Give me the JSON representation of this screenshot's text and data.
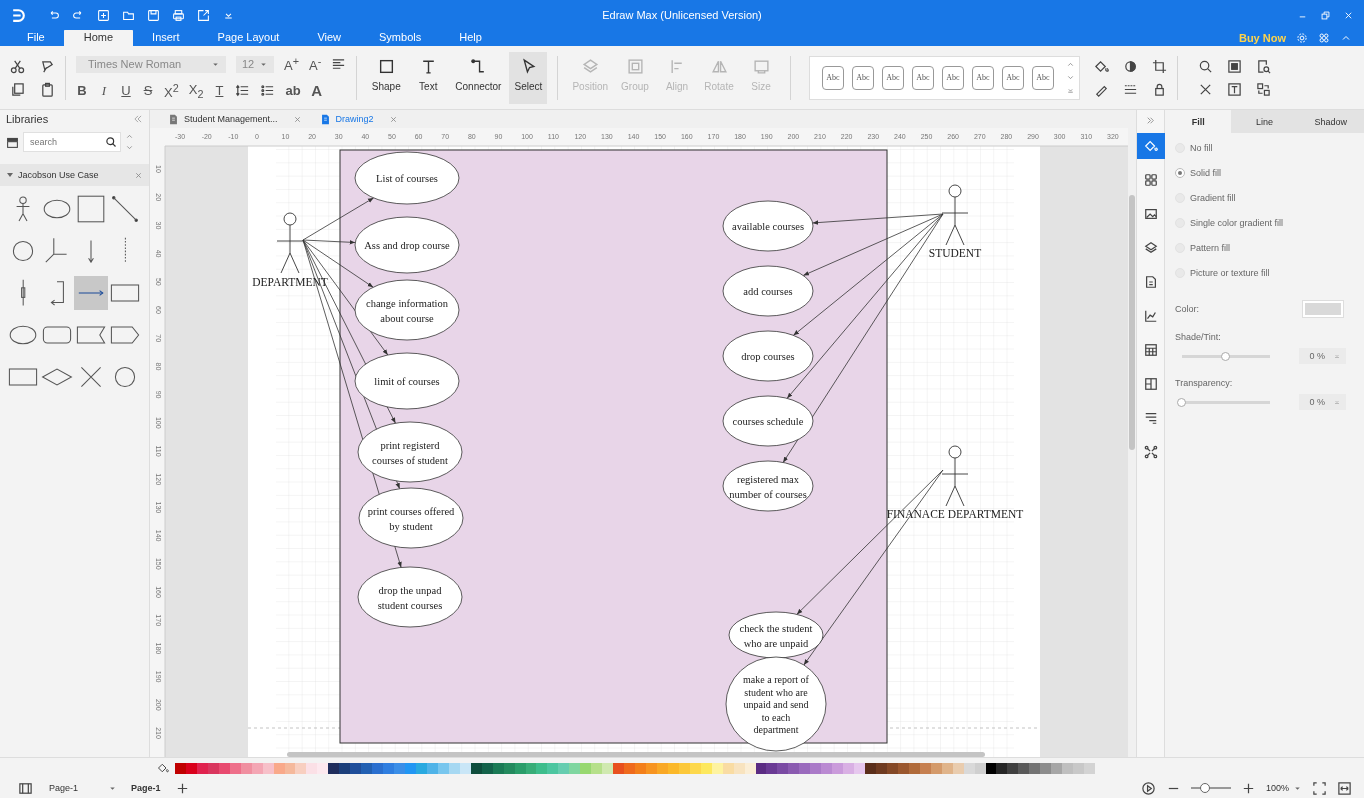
{
  "window": {
    "title": "Edraw Max (Unlicensed Version)"
  },
  "menu_tabs": [
    {
      "label": "File",
      "selected": false
    },
    {
      "label": "Home",
      "selected": true
    },
    {
      "label": "Insert",
      "selected": false
    },
    {
      "label": "Page Layout",
      "selected": false
    },
    {
      "label": "View",
      "selected": false
    },
    {
      "label": "Symbols",
      "selected": false
    },
    {
      "label": "Help",
      "selected": false
    }
  ],
  "buy_now": "Buy Now",
  "ribbon": {
    "font_family": "Times New Roman",
    "font_size": "12",
    "size_buttons": [
      "A$^{+}$",
      "A$^{-}$"
    ],
    "format_buttons": [
      {
        "label": "B",
        "kind": "bold"
      },
      {
        "label": "I",
        "kind": "italic"
      },
      {
        "label": "U",
        "kind": "underline"
      },
      {
        "label": "S",
        "kind": "strike"
      },
      {
        "label": "X$^{2}$",
        "kind": "plain"
      },
      {
        "label": "X$_{2}$",
        "kind": "plain"
      },
      {
        "label": "T",
        "kind": "underline"
      },
      {
        "label": "ab",
        "kind": "bold"
      },
      {
        "label": "A",
        "kind": "large"
      }
    ],
    "tools": [
      {
        "label": "Shape",
        "kind": "shape",
        "selected": false,
        "disabled": false
      },
      {
        "label": "Text",
        "kind": "text",
        "selected": false,
        "disabled": false
      },
      {
        "label": "Connector",
        "kind": "connector",
        "selected": false,
        "disabled": false
      },
      {
        "label": "Select",
        "kind": "select",
        "selected": true,
        "disabled": false
      },
      {
        "label": "Position",
        "kind": "position",
        "selected": false,
        "disabled": true
      },
      {
        "label": "Group",
        "kind": "group",
        "selected": false,
        "disabled": true
      },
      {
        "label": "Align",
        "kind": "align",
        "selected": false,
        "disabled": true
      },
      {
        "label": "Rotate",
        "kind": "rotate",
        "selected": false,
        "disabled": true
      },
      {
        "label": "Size",
        "kind": "size",
        "selected": false,
        "disabled": true
      }
    ],
    "styles": [
      "Abc",
      "Abc",
      "Abc",
      "Abc",
      "Abc",
      "Abc",
      "Abc",
      "Abc"
    ]
  },
  "libraries": {
    "title": "Libraries",
    "search": {
      "placeholder": "search"
    },
    "category": {
      "label": "Jacobson Use Case",
      "expanded": true
    },
    "shapes": [
      {
        "kind": "actor",
        "selected": false
      },
      {
        "kind": "ellipse",
        "selected": false
      },
      {
        "kind": "square",
        "selected": false
      },
      {
        "kind": "line",
        "selected": false
      },
      {
        "kind": "circle",
        "selected": false
      },
      {
        "kind": "branch",
        "selected": false
      },
      {
        "kind": "arrow-down",
        "selected": false
      },
      {
        "kind": "dotted",
        "selected": false
      },
      {
        "kind": "bar",
        "selected": false
      },
      {
        "kind": "elbow",
        "selected": false
      },
      {
        "kind": "arrow-right",
        "selected": true
      },
      {
        "kind": "rect",
        "selected": false
      },
      {
        "kind": "ellipse",
        "selected": false
      },
      {
        "kind": "rounded",
        "selected": false
      },
      {
        "kind": "ribbon",
        "selected": false
      },
      {
        "kind": "pentagon",
        "selected": false
      },
      {
        "kind": "rect",
        "selected": false
      },
      {
        "kind": "diamond",
        "selected": false
      },
      {
        "kind": "cross",
        "selected": false
      },
      {
        "kind": "circle",
        "selected": false
      }
    ]
  },
  "document_tabs": [
    {
      "label": "Student Management...",
      "selected": false
    },
    {
      "label": "Drawing2",
      "selected": true
    }
  ],
  "ruler": {
    "horizontal": [
      "-30",
      "-20",
      "-10",
      "0",
      "10",
      "20",
      "30",
      "40",
      "50",
      "60",
      "70",
      "80",
      "90",
      "100",
      "110",
      "120",
      "130",
      "140",
      "150",
      "160",
      "170",
      "180",
      "190",
      "200",
      "210",
      "220",
      "230",
      "240",
      "250",
      "260",
      "270",
      "280",
      "290",
      "300",
      "310",
      "320"
    ],
    "vertical": [
      "10",
      "20",
      "30",
      "40",
      "50",
      "60",
      "70",
      "80",
      "90",
      "100",
      "110",
      "120",
      "130",
      "140",
      "150",
      "160",
      "170",
      "180",
      "190",
      "200",
      "210"
    ]
  },
  "diagram": {
    "actors": [
      {
        "label": "DEPARTMENT",
        "use_cases": [
          {
            "lines": [
              "List of courses"
            ]
          },
          {
            "lines": [
              "Ass and drop course"
            ]
          },
          {
            "lines": [
              "change information",
              "about course"
            ]
          },
          {
            "lines": [
              "limit of courses"
            ]
          },
          {
            "lines": [
              "print registerd",
              "courses of student"
            ]
          },
          {
            "lines": [
              "print courses offered",
              "by student"
            ]
          },
          {
            "lines": [
              "drop the unpad",
              "student courses"
            ]
          }
        ]
      },
      {
        "label": "STUDENT",
        "use_cases": [
          {
            "lines": [
              "available courses"
            ]
          },
          {
            "lines": [
              "add courses"
            ]
          },
          {
            "lines": [
              "drop courses"
            ]
          },
          {
            "lines": [
              "courses schedule"
            ]
          },
          {
            "lines": [
              "registered max",
              "number of courses"
            ]
          }
        ]
      },
      {
        "label": "FINANACE DEPARTMENT",
        "use_cases": [
          {
            "lines": [
              "check the student",
              "who are unpaid"
            ]
          },
          {
            "lines": [
              "make a report of",
              "student who are",
              "unpaid and send",
              "to each",
              "department"
            ]
          }
        ]
      }
    ]
  },
  "side_tools": [
    {
      "kind": "fill",
      "selected": true
    },
    {
      "kind": "theme",
      "selected": false
    },
    {
      "kind": "image",
      "selected": false
    },
    {
      "kind": "layers",
      "selected": false
    },
    {
      "kind": "page",
      "selected": false
    },
    {
      "kind": "chart",
      "selected": false
    },
    {
      "kind": "table",
      "selected": false
    },
    {
      "kind": "puzzle",
      "selected": false
    },
    {
      "kind": "wrap",
      "selected": false
    },
    {
      "kind": "network",
      "selected": false
    }
  ],
  "format_panel": {
    "tabs": [
      {
        "label": "Fill",
        "selected": true
      },
      {
        "label": "Line",
        "selected": false
      },
      {
        "label": "Shadow",
        "selected": false
      }
    ],
    "fill_options": [
      {
        "label": "No fill",
        "selected": false
      },
      {
        "label": "Solid fill",
        "selected": true
      },
      {
        "label": "Gradient fill",
        "selected": false
      },
      {
        "label": "Single color gradient fill",
        "selected": false
      },
      {
        "label": "Pattern fill",
        "selected": false
      },
      {
        "label": "Picture or texture fill",
        "selected": false
      }
    ],
    "color": {
      "label": "Color:",
      "color": "#d9d9d9"
    },
    "shade": {
      "label": "Shade/Tint:",
      "level": 0.5,
      "value": "0 %"
    },
    "transparency": {
      "label": "Transparency:",
      "level": 0,
      "value": "0 %"
    }
  },
  "palette": [
    {
      "color": "#c00000"
    },
    {
      "color": "#d9001b"
    },
    {
      "color": "#e0224e"
    },
    {
      "color": "#d9365e"
    },
    {
      "color": "#e84a6f"
    },
    {
      "color": "#ee6f8a"
    },
    {
      "color": "#f08fa0"
    },
    {
      "color": "#f4a6b4"
    },
    {
      "color": "#f7c0c9"
    },
    {
      "color": "#f9a98a"
    },
    {
      "color": "#f5b99c"
    },
    {
      "color": "#f8cfc0"
    },
    {
      "color": "#fbe0e6"
    },
    {
      "color": "#fde9ef"
    },
    {
      "color": "#1f2d5c"
    },
    {
      "color": "#1c3f7a"
    },
    {
      "color": "#1f4e9a"
    },
    {
      "color": "#2260b2"
    },
    {
      "color": "#2a6fcf"
    },
    {
      "color": "#2f7ee0"
    },
    {
      "color": "#3a8ee8"
    },
    {
      "color": "#2196f3"
    },
    {
      "color": "#29a9e0"
    },
    {
      "color": "#4fb3e8"
    },
    {
      "color": "#78c6ee"
    },
    {
      "color": "#a6d8f2"
    },
    {
      "color": "#c9e6f7"
    },
    {
      "color": "#0e4d3c"
    },
    {
      "color": "#13624a"
    },
    {
      "color": "#1a7a55"
    },
    {
      "color": "#238a5e"
    },
    {
      "color": "#2a9d6a"
    },
    {
      "color": "#37ad78"
    },
    {
      "color": "#3dbd8c"
    },
    {
      "color": "#4cc6a0"
    },
    {
      "color": "#66cdb0"
    },
    {
      "color": "#7fd6a0"
    },
    {
      "color": "#98d870"
    },
    {
      "color": "#b6e08a"
    },
    {
      "color": "#d0e9b0"
    },
    {
      "color": "#e8501e"
    },
    {
      "color": "#ef6a1c"
    },
    {
      "color": "#f37f1a"
    },
    {
      "color": "#f79420"
    },
    {
      "color": "#f9a825"
    },
    {
      "color": "#fbb829"
    },
    {
      "color": "#fcc83a"
    },
    {
      "color": "#fdd84c"
    },
    {
      "color": "#fde85e"
    },
    {
      "color": "#fef3a0"
    },
    {
      "color": "#f9dca3"
    },
    {
      "color": "#f8e3bf"
    },
    {
      "color": "#fbeed6"
    },
    {
      "color": "#5b2c83"
    },
    {
      "color": "#6a3a94"
    },
    {
      "color": "#7a4aa3"
    },
    {
      "color": "#8a5ab0"
    },
    {
      "color": "#9a6abd"
    },
    {
      "color": "#aa7ac8"
    },
    {
      "color": "#ba8ad2"
    },
    {
      "color": "#ca9bdb"
    },
    {
      "color": "#d9b0e4"
    },
    {
      "color": "#e6c7ee"
    },
    {
      "color": "#5a2e1a"
    },
    {
      "color": "#6e3a20"
    },
    {
      "color": "#844826"
    },
    {
      "color": "#9a572e"
    },
    {
      "color": "#b06a3a"
    },
    {
      "color": "#c68050"
    },
    {
      "color": "#d49a6a"
    },
    {
      "color": "#e0b48a"
    },
    {
      "color": "#e9ccae"
    },
    {
      "color": "#d9d9d9"
    },
    {
      "color": "#cfcfcf"
    },
    {
      "color": "#000000"
    },
    {
      "color": "#262626"
    },
    {
      "color": "#404040"
    },
    {
      "color": "#595959"
    },
    {
      "color": "#737373"
    },
    {
      "color": "#8c8c8c"
    },
    {
      "color": "#a6a6a6"
    },
    {
      "color": "#bfbfbf"
    },
    {
      "color": "#c8c8c8"
    },
    {
      "color": "#d3d3d3"
    }
  ],
  "status_bar": {
    "page_selector": "Page-1",
    "pages": [
      {
        "label": "Page-1",
        "selected": true
      }
    ],
    "zoom": {
      "level": 0.35,
      "value": "100%"
    }
  }
}
